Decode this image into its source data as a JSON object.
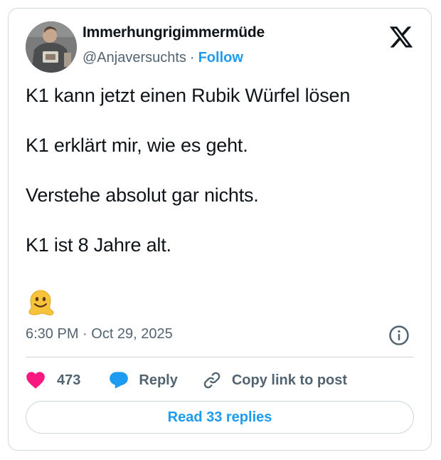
{
  "author": {
    "display_name": "Immerhungrigimmermüde",
    "handle": "@Anjaversuchts",
    "separator": "·",
    "follow_label": "Follow"
  },
  "tweet": {
    "paragraphs": [
      "K1 kann jetzt einen Rubik Würfel lösen",
      "K1 erklärt mir, wie es geht.",
      "Verstehe absolut gar nichts.",
      "K1 ist 8 Jahre alt."
    ],
    "emoji": "melting-face",
    "timestamp": "6:30 PM · Oct 29, 2025"
  },
  "actions": {
    "like_count": "473",
    "reply_label": "Reply",
    "copy_label": "Copy link to post"
  },
  "footer": {
    "read_replies_label": "Read 33 replies"
  },
  "icons": {
    "brand": "x-logo-icon",
    "info": "info-icon",
    "like": "heart-icon",
    "reply": "speech-bubble-icon",
    "copy": "link-icon"
  },
  "colors": {
    "accent": "#1d9bf0",
    "like": "#f91880",
    "text": "#0f1419",
    "muted": "#536471",
    "border": "#cfd9de"
  }
}
